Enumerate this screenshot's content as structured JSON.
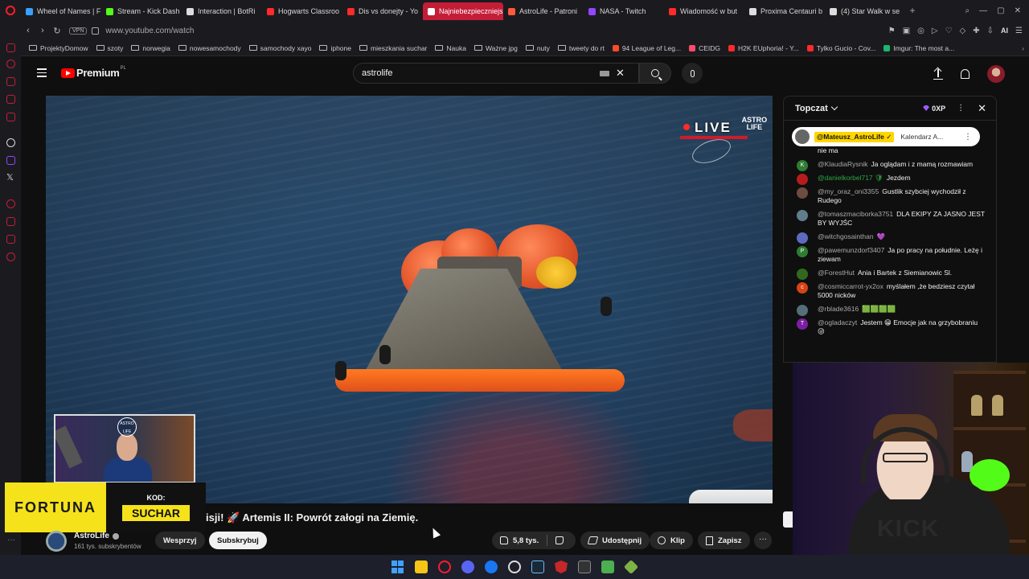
{
  "browser": {
    "tabs": [
      {
        "label": "Wheel of Names | F",
        "color": "#3aa0ff",
        "active": false
      },
      {
        "label": "Stream - Kick Dash",
        "color": "#53fc18",
        "active": false
      },
      {
        "label": "Interaction | BotRi",
        "color": "#dddddd",
        "active": false
      },
      {
        "label": "Hogwarts Classroo",
        "color": "#ff2a2a",
        "active": false
      },
      {
        "label": "Dis vs donejty - Yo",
        "color": "#ff2a2a",
        "active": false
      },
      {
        "label": "Najniebezpieczniejs",
        "color": "#ffffff",
        "active": true
      },
      {
        "label": "AstroLife - Patroni",
        "color": "#ff5a3a",
        "active": false
      },
      {
        "label": "NASA - Twitch",
        "color": "#9146ff",
        "active": false
      },
      {
        "label": "Wiadomość w but",
        "color": "#ff2a2a",
        "active": false
      },
      {
        "label": "Proxima Centauri b",
        "color": "#dddddd",
        "active": false
      },
      {
        "label": "(4) Star Walk w se",
        "color": "#dddddd",
        "active": false
      }
    ],
    "url": "www.youtube.com/watch",
    "vpn_label": "VPN",
    "ai_label": "AI",
    "bookmarks": [
      {
        "label": "ProjektyDomow",
        "type": "folder"
      },
      {
        "label": "szoty",
        "type": "folder"
      },
      {
        "label": "norwegia",
        "type": "folder"
      },
      {
        "label": "nowesamochody",
        "type": "folder"
      },
      {
        "label": "samochody xayo",
        "type": "folder"
      },
      {
        "label": "iphone",
        "type": "folder"
      },
      {
        "label": "mieszkania suchar",
        "type": "folder"
      },
      {
        "label": "Nauka",
        "type": "folder"
      },
      {
        "label": "Ważne jpg",
        "type": "folder"
      },
      {
        "label": "nuty",
        "type": "folder"
      },
      {
        "label": "tweety do rt",
        "type": "folder"
      },
      {
        "label": "94 League of Leg...",
        "type": "site",
        "color": "#ff4a2a"
      },
      {
        "label": "CEIDG",
        "type": "site",
        "color": "#ff4a6a"
      },
      {
        "label": "H2K EUphoria! - Y...",
        "type": "site",
        "color": "#ff2a2a"
      },
      {
        "label": "Tylko Gucio - Cov...",
        "type": "site",
        "color": "#ff2a2a"
      },
      {
        "label": "Imgur: The most a...",
        "type": "site",
        "color": "#1bb76e"
      }
    ]
  },
  "youtube": {
    "logo_text": "Premium",
    "logo_region": "PL",
    "search_value": "astrolife",
    "video": {
      "live_label": "LIVE",
      "astro_mark": "ASTRO LIFE",
      "title": "isji! 🚀 Artemis II: Powrót załogi na Ziemię.",
      "channel_name": "AstroLife",
      "subscribers": "161 tys. subskrybentów",
      "support_label": "Wesprzyj",
      "subscribe_label": "Subskrybuj",
      "likes": "5,8 tys.",
      "share_label": "Udostępnij",
      "clip_label": "Klip",
      "save_label": "Zapisz"
    },
    "ad": {
      "brand": "FORTUNA",
      "code_label": "KOD:",
      "code_value": "SUCHAR"
    },
    "chat": {
      "title": "Topczat",
      "xp": "0XP",
      "pinned": {
        "author": "@Mateusz_AstroLife ✓",
        "text": "Kalendarz A..."
      },
      "messages": [
        {
          "author": "",
          "text": "nie ma",
          "avatar": "",
          "avatar_color": "#444444",
          "mod": false
        },
        {
          "author": "@KlaudiaRysnik",
          "text": "Ja oglądam i z mamą rozmawiam",
          "avatar": "K",
          "avatar_color": "#2e7d32",
          "mod": false
        },
        {
          "author": "@danielkorbel717 🛡",
          "text": "Jezdem",
          "avatar": "",
          "avatar_color": "#b71c1c",
          "mod": true
        },
        {
          "author": "@my_oraz_oni3355",
          "text": "Gustlik szybciej wychodził z Rudego",
          "avatar": "",
          "avatar_color": "#6d4c41",
          "mod": false
        },
        {
          "author": "@tomaszmaciborka3751",
          "text": "DLA EKIPY ZA JASNO JEST BY WYJŚC",
          "avatar": "",
          "avatar_color": "#607d8b",
          "mod": false
        },
        {
          "author": "@witchgosainthan",
          "text": "💜",
          "avatar": "",
          "avatar_color": "#5c6bc0",
          "mod": false
        },
        {
          "author": "@pawemunzdorf3407",
          "text": "Ja po pracy na południe. Leżę i ziewam",
          "avatar": "P",
          "avatar_color": "#2e7d32",
          "mod": false
        },
        {
          "author": "@ForestHut",
          "text": "Ania i Bartek z Siemianowic Sl.",
          "avatar": "",
          "avatar_color": "#33691e",
          "mod": false
        },
        {
          "author": "@cosmiccarrot-yx2ox",
          "text": "myślałem ,że bedziesz czytał 5000 nicków",
          "avatar": "c",
          "avatar_color": "#d84315",
          "mod": false
        },
        {
          "author": "@rblade3616",
          "text": "🟩🟩🟩🟩",
          "avatar": "",
          "avatar_color": "#546e7a",
          "mod": false
        },
        {
          "author": "@ogladaczyt",
          "text": "Jestem 😁 Emocje jak na grzybobraniu 😜",
          "avatar": "T",
          "avatar_color": "#7b1fa2",
          "mod": false
        }
      ]
    }
  },
  "webcam": {
    "shirt_text": "KICK"
  }
}
